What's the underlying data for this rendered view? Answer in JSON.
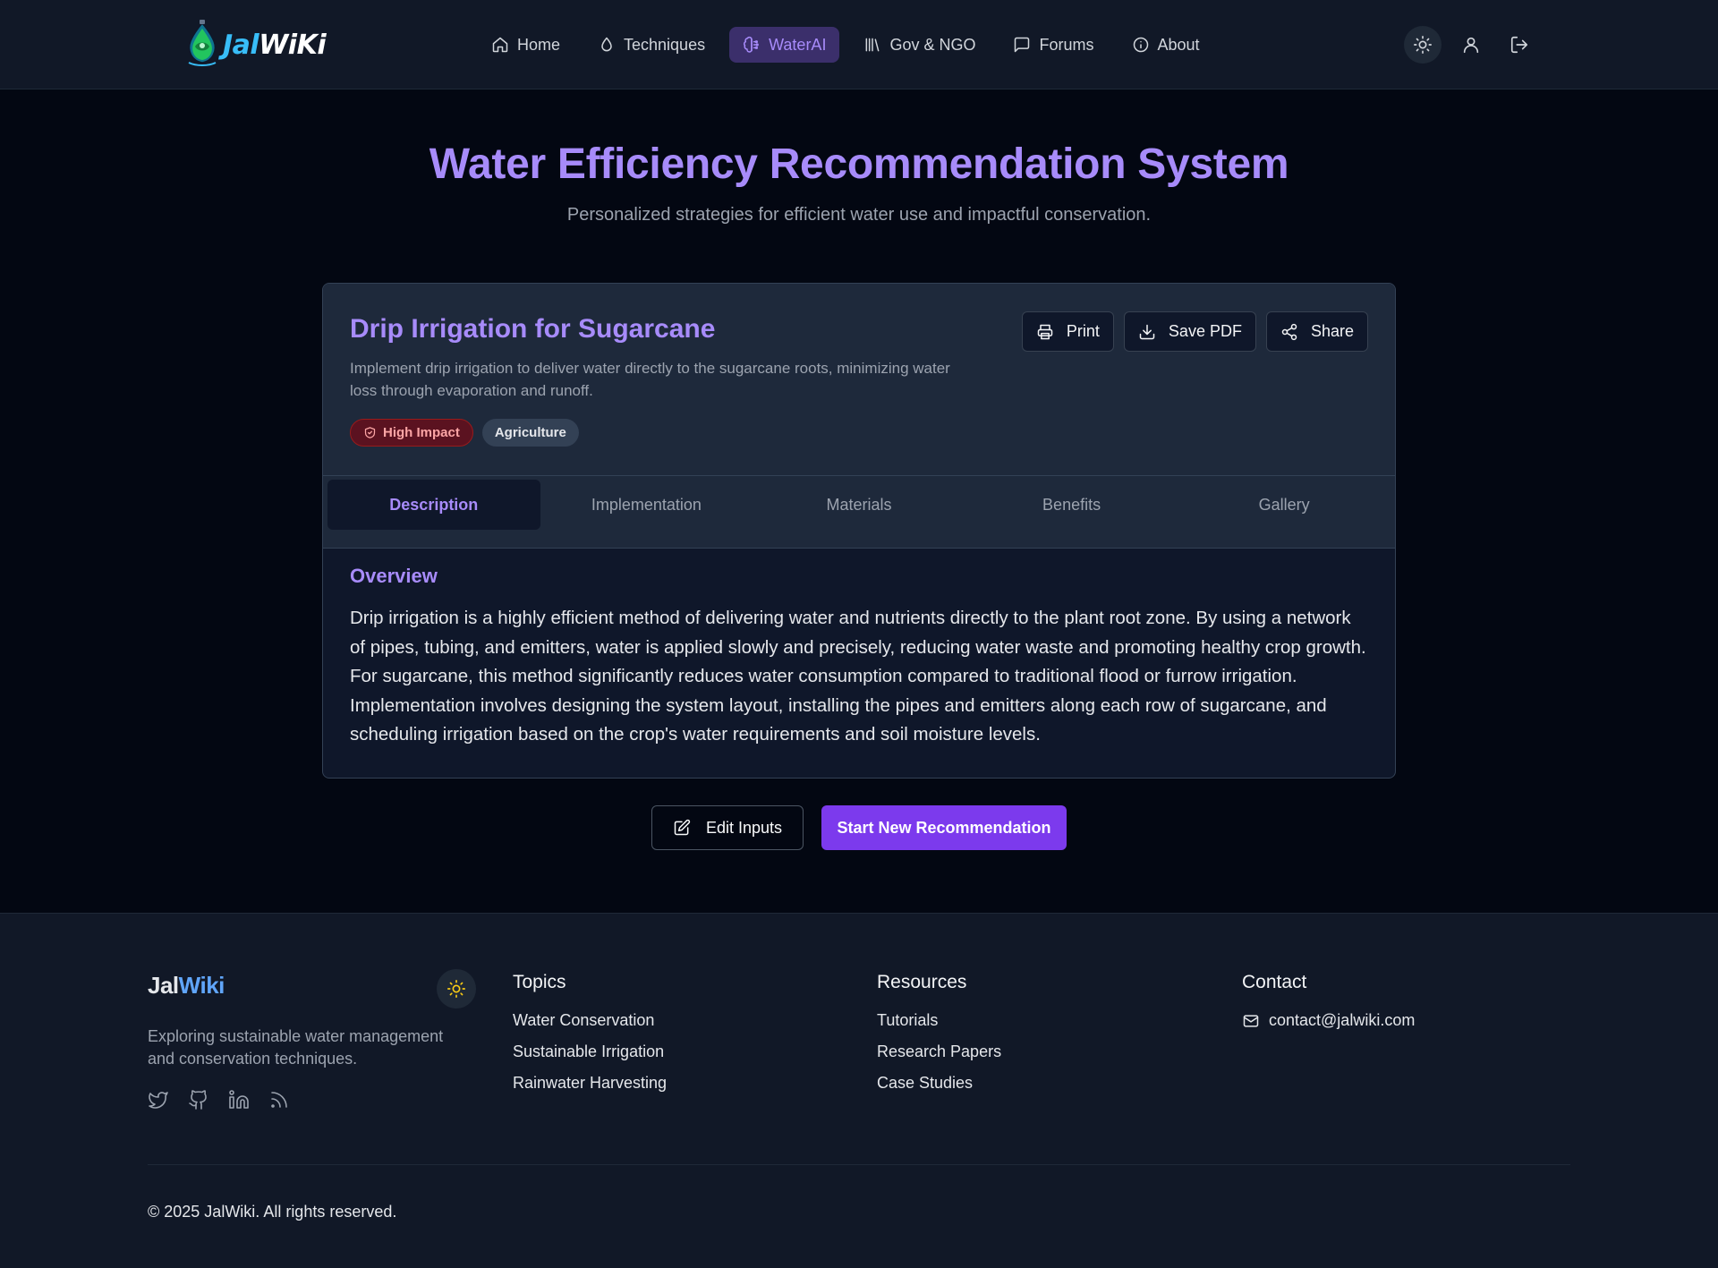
{
  "header": {
    "logo": {
      "part1": "Jal",
      "part2": "WiKi"
    },
    "nav": [
      {
        "label": "Home",
        "icon": "home-icon"
      },
      {
        "label": "Techniques",
        "icon": "droplet-icon"
      },
      {
        "label": "WaterAI",
        "icon": "brain-icon",
        "active": true
      },
      {
        "label": "Gov & NGO",
        "icon": "library-icon"
      },
      {
        "label": "Forums",
        "icon": "message-square-icon"
      },
      {
        "label": "About",
        "icon": "info-icon"
      }
    ],
    "actions": [
      "sun-icon",
      "user-icon",
      "logout-icon"
    ]
  },
  "hero": {
    "title": "Water Efficiency Recommendation System",
    "subtitle": "Personalized strategies for efficient water use and impactful conservation."
  },
  "recommendation": {
    "title": "Drip Irrigation for Sugarcane",
    "description": "Implement drip irrigation to deliver water directly to the sugarcane roots, minimizing water loss through evaporation and runoff.",
    "badges": {
      "impact": "High Impact",
      "category": "Agriculture"
    },
    "actions": {
      "print": "Print",
      "save_pdf": "Save PDF",
      "share": "Share"
    },
    "tabs": [
      "Description",
      "Implementation",
      "Materials",
      "Benefits",
      "Gallery"
    ],
    "active_tab": "Description",
    "overview": {
      "heading": "Overview",
      "text": "Drip irrigation is a highly efficient method of delivering water and nutrients directly to the plant root zone. By using a network of pipes, tubing, and emitters, water is applied slowly and precisely, reducing water waste and promoting healthy crop growth. For sugarcane, this method significantly reduces water consumption compared to traditional flood or furrow irrigation. Implementation involves designing the system layout, installing the pipes and emitters along each row of sugarcane, and scheduling irrigation based on the crop's water requirements and soil moisture levels."
    }
  },
  "buttons": {
    "edit": "Edit Inputs",
    "start": "Start New Recommendation"
  },
  "footer": {
    "brand": {
      "part1": "Jal",
      "part2": "Wiki"
    },
    "tagline": "Exploring sustainable water management and conservation techniques.",
    "socials": [
      "twitter-icon",
      "github-icon",
      "linkedin-icon",
      "rss-icon"
    ],
    "topics": {
      "heading": "Topics",
      "items": [
        "Water Conservation",
        "Sustainable Irrigation",
        "Rainwater Harvesting"
      ]
    },
    "resources": {
      "heading": "Resources",
      "items": [
        "Tutorials",
        "Research Papers",
        "Case Studies"
      ]
    },
    "contact": {
      "heading": "Contact",
      "email": "contact@jalwiki.com"
    },
    "copyright": "© 2025 JalWiki. All rights reserved."
  },
  "colors": {
    "accent": "#a78bfa",
    "primary_button": "#7c3aed",
    "background": "#030712",
    "surface": "#111827",
    "card": "#0f172a",
    "card_header": "#1e293b",
    "impact_badge": "#5b1220",
    "brand_blue": "#38bdf8"
  }
}
